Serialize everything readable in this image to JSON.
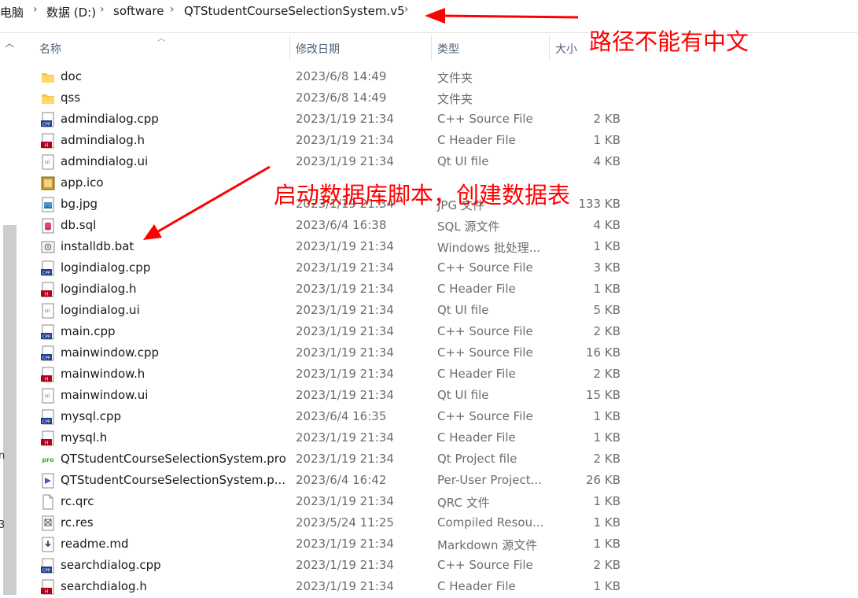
{
  "breadcrumb": [
    "电脑",
    "数据 (D:)",
    "software",
    "QTStudentCourseSelectionSystem.v5"
  ],
  "columns": {
    "name": "名称",
    "modified": "修改日期",
    "type": "类型",
    "size": "大小"
  },
  "left_edge": [
    "n",
    "3"
  ],
  "annotations": {
    "path_note": "路径不能有中文",
    "bat_note": "启动数据库脚本，创建数据表"
  },
  "annotation_color": "#ff0000",
  "files": [
    {
      "name": "doc",
      "date": "2023/6/8 14:49",
      "type": "文件夹",
      "size": "",
      "icon": "folder-icon"
    },
    {
      "name": "qss",
      "date": "2023/6/8 14:49",
      "type": "文件夹",
      "size": "",
      "icon": "folder-icon"
    },
    {
      "name": "admindialog.cpp",
      "date": "2023/1/19 21:34",
      "type": "C++ Source File",
      "size": "2 KB",
      "icon": "cpp-file-icon"
    },
    {
      "name": "admindialog.h",
      "date": "2023/1/19 21:34",
      "type": "C Header File",
      "size": "1 KB",
      "icon": "header-file-icon"
    },
    {
      "name": "admindialog.ui",
      "date": "2023/1/19 21:34",
      "type": "Qt UI file",
      "size": "4 KB",
      "icon": "ui-file-icon"
    },
    {
      "name": "app.ico",
      "date": "",
      "type": "",
      "size": "",
      "icon": "ico-file-icon"
    },
    {
      "name": "bg.jpg",
      "date": "2023/1/19 21:34",
      "type": "JPG 文件",
      "size": "133 KB",
      "icon": "image-file-icon"
    },
    {
      "name": "db.sql",
      "date": "2023/6/4 16:38",
      "type": "SQL 源文件",
      "size": "4 KB",
      "icon": "sql-file-icon"
    },
    {
      "name": "installdb.bat",
      "date": "2023/1/19 21:34",
      "type": "Windows 批处理...",
      "size": "1 KB",
      "icon": "bat-file-icon"
    },
    {
      "name": "logindialog.cpp",
      "date": "2023/1/19 21:34",
      "type": "C++ Source File",
      "size": "3 KB",
      "icon": "cpp-file-icon"
    },
    {
      "name": "logindialog.h",
      "date": "2023/1/19 21:34",
      "type": "C Header File",
      "size": "1 KB",
      "icon": "header-file-icon"
    },
    {
      "name": "logindialog.ui",
      "date": "2023/1/19 21:34",
      "type": "Qt UI file",
      "size": "5 KB",
      "icon": "ui-file-icon"
    },
    {
      "name": "main.cpp",
      "date": "2023/1/19 21:34",
      "type": "C++ Source File",
      "size": "2 KB",
      "icon": "cpp-file-icon"
    },
    {
      "name": "mainwindow.cpp",
      "date": "2023/1/19 21:34",
      "type": "C++ Source File",
      "size": "16 KB",
      "icon": "cpp-file-icon"
    },
    {
      "name": "mainwindow.h",
      "date": "2023/1/19 21:34",
      "type": "C Header File",
      "size": "2 KB",
      "icon": "header-file-icon"
    },
    {
      "name": "mainwindow.ui",
      "date": "2023/1/19 21:34",
      "type": "Qt UI file",
      "size": "15 KB",
      "icon": "ui-file-icon"
    },
    {
      "name": "mysql.cpp",
      "date": "2023/6/4 16:35",
      "type": "C++ Source File",
      "size": "1 KB",
      "icon": "cpp-file-icon"
    },
    {
      "name": "mysql.h",
      "date": "2023/1/19 21:34",
      "type": "C Header File",
      "size": "1 KB",
      "icon": "header-file-icon"
    },
    {
      "name": "QTStudentCourseSelectionSystem.pro",
      "date": "2023/1/19 21:34",
      "type": "Qt Project file",
      "size": "2 KB",
      "icon": "pro-file-icon"
    },
    {
      "name": "QTStudentCourseSelectionSystem.p...",
      "date": "2023/6/4 16:42",
      "type": "Per-User Project...",
      "size": "26 KB",
      "icon": "user-project-file-icon"
    },
    {
      "name": "rc.qrc",
      "date": "2023/1/19 21:34",
      "type": "QRC 文件",
      "size": "1 KB",
      "icon": "blank-file-icon"
    },
    {
      "name": "rc.res",
      "date": "2023/5/24 11:25",
      "type": "Compiled Resou...",
      "size": "1 KB",
      "icon": "res-file-icon"
    },
    {
      "name": "readme.md",
      "date": "2023/1/19 21:34",
      "type": "Markdown 源文件",
      "size": "1 KB",
      "icon": "markdown-file-icon"
    },
    {
      "name": "searchdialog.cpp",
      "date": "2023/1/19 21:34",
      "type": "C++ Source File",
      "size": "2 KB",
      "icon": "cpp-file-icon"
    },
    {
      "name": "searchdialog.h",
      "date": "2023/1/19 21:34",
      "type": "C Header File",
      "size": "1 KB",
      "icon": "header-file-icon"
    }
  ]
}
